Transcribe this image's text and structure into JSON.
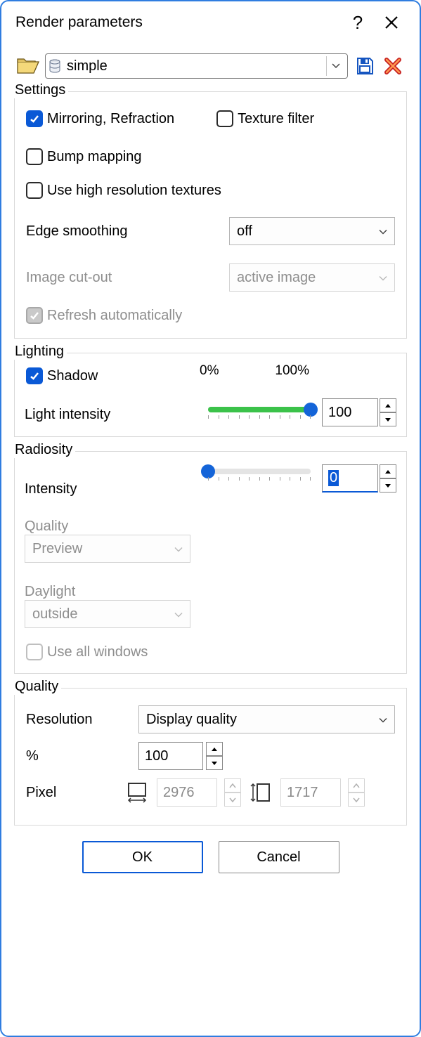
{
  "title": "Render parameters",
  "preset": {
    "value": "simple"
  },
  "settings": {
    "legend": "Settings",
    "mirroring_label": "Mirroring, Refraction",
    "texture_filter_label": "Texture filter",
    "bump_label": "Bump mapping",
    "highres_label": "Use high resolution textures",
    "edge_label": "Edge smoothing",
    "edge_value": "off",
    "cutout_label": "Image cut-out",
    "cutout_value": "active image",
    "refresh_label": "Refresh automatically"
  },
  "lighting": {
    "legend": "Lighting",
    "shadow_label": "Shadow",
    "min_label": "0%",
    "max_label": "100%",
    "intensity_label": "Light intensity",
    "intensity_value": "100"
  },
  "radiosity": {
    "legend": "Radiosity",
    "intensity_label": "Intensity",
    "intensity_value": "0",
    "quality_label": "Quality",
    "quality_value": "Preview",
    "daylight_label": "Daylight",
    "daylight_value": "outside",
    "all_windows_label": "Use all windows"
  },
  "quality": {
    "legend": "Quality",
    "resolution_label": "Resolution",
    "resolution_value": "Display quality",
    "percent_label": "%",
    "percent_value": "100",
    "pixel_label": "Pixel",
    "width_value": "2976",
    "height_value": "1717"
  },
  "buttons": {
    "ok": "OK",
    "cancel": "Cancel"
  }
}
